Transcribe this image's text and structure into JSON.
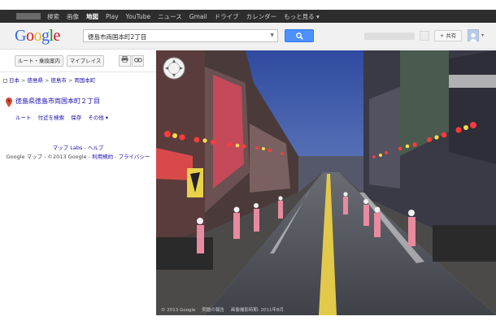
{
  "topnav": {
    "items": [
      "検索",
      "画像",
      "地図",
      "Play",
      "YouTube",
      "ニュース",
      "Gmail",
      "ドライブ",
      "カレンダー",
      "もっと見る ▾"
    ],
    "active_index": 2
  },
  "header": {
    "logo_letters": [
      "G",
      "o",
      "o",
      "g",
      "l",
      "e"
    ],
    "search_value": "徳島市両国本町2丁目",
    "share_label": "+ 共有"
  },
  "sidebar": {
    "route_button": "ルート・乗換案内",
    "myplaces_button": "マイプレイス",
    "print_icon": "print-icon",
    "link_icon": "link-icon",
    "breadcrumb": [
      "日本",
      "徳島県",
      "徳島市",
      "両国本町"
    ],
    "place_title": "徳島県徳島市両国本町２丁目",
    "actions": [
      "ルート",
      "付近を検索",
      "保存",
      "その他 ▾"
    ],
    "footer_line1": "マップ Labs - ヘルプ",
    "footer_copyright": "Google マップ - ©2013 Google - ",
    "footer_terms": "利用規約",
    "footer_privacy": "プライバシー"
  },
  "streetview": {
    "caption_copyright": "© 2013 Google",
    "caption_problem": "問題の報告",
    "caption_date": "画像撮影時期: 2011年8月"
  },
  "colors": {
    "topbar": "#2d2d2d",
    "search_button": "#4d90fe",
    "link": "#1a0dab",
    "pin": "#d44b38"
  }
}
